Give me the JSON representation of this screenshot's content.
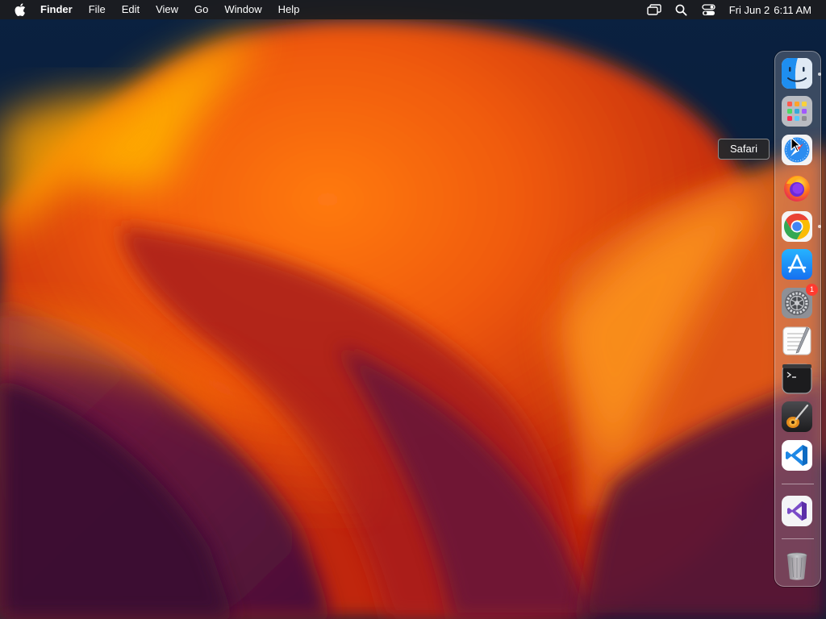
{
  "menubar": {
    "apple_icon": "apple-logo-icon",
    "app_name": "Finder",
    "menus": [
      "File",
      "Edit",
      "View",
      "Go",
      "Window",
      "Help"
    ],
    "status_icons": [
      "screen-mirroring-icon",
      "spotlight-search-icon",
      "control-center-icon"
    ],
    "clock": {
      "date": "Fri Jun 2",
      "time": "6:11 AM"
    }
  },
  "dock": {
    "apps": [
      {
        "name": "Finder",
        "icon": "finder-icon",
        "running": true
      },
      {
        "name": "Launchpad",
        "icon": "launchpad-icon",
        "running": false
      },
      {
        "name": "Safari",
        "icon": "safari-icon",
        "running": false
      },
      {
        "name": "Firefox",
        "icon": "firefox-icon",
        "running": false
      },
      {
        "name": "Google Chrome",
        "icon": "chrome-icon",
        "running": true
      },
      {
        "name": "App Store",
        "icon": "app-store-icon",
        "running": false
      },
      {
        "name": "System Settings",
        "icon": "system-settings-icon",
        "running": false,
        "badge": "1"
      },
      {
        "name": "TextEdit",
        "icon": "textedit-icon",
        "running": false
      },
      {
        "name": "Terminal",
        "icon": "terminal-icon",
        "running": false
      },
      {
        "name": "GarageBand",
        "icon": "garageband-icon",
        "running": false
      },
      {
        "name": "Visual Studio Code",
        "icon": "vscode-icon",
        "running": false
      }
    ],
    "recent": [
      {
        "name": "Visual Studio",
        "icon": "visual-studio-icon"
      }
    ],
    "trash": {
      "name": "Trash",
      "icon": "trash-icon"
    },
    "tooltip": "Safari",
    "accent_colors": {
      "badge": "#ff3b30",
      "vscode": "#1e88e5",
      "appstore": "#1a8cff"
    }
  }
}
